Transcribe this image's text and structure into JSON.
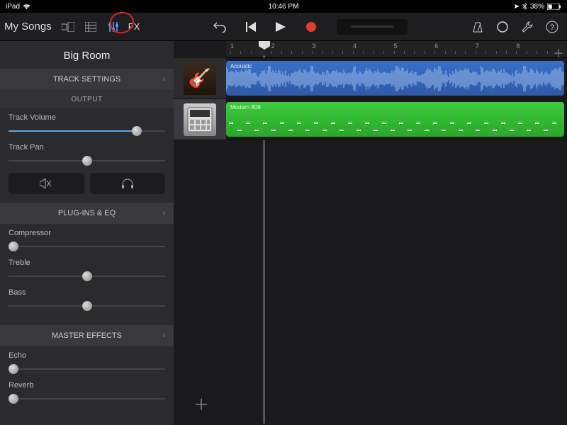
{
  "status": {
    "device": "iPad",
    "time": "10:46 PM",
    "battery": "38%"
  },
  "toolbar": {
    "my_songs": "My Songs",
    "fx": "FX"
  },
  "song": {
    "title": "Big Room"
  },
  "sections": {
    "track_settings": "TRACK SETTINGS",
    "output": "OUTPUT",
    "plugins_eq": "PLUG-INS & EQ",
    "master_effects": "MASTER EFFECTS"
  },
  "output": {
    "track_volume_label": "Track Volume",
    "track_volume": 82,
    "track_pan_label": "Track Pan",
    "track_pan": 50
  },
  "plugins": {
    "compressor_label": "Compressor",
    "compressor": 0,
    "treble_label": "Treble",
    "treble": 45,
    "bass_label": "Bass",
    "bass": 45
  },
  "master": {
    "echo_label": "Echo",
    "echo": 0,
    "reverb_label": "Reverb",
    "reverb": 0
  },
  "ruler": {
    "bars": [
      1,
      2,
      3,
      4,
      5,
      6,
      7,
      8
    ]
  },
  "tracks": [
    {
      "name": "Acoustic",
      "instrument": "guitar",
      "region_label": "Acoustic",
      "color": "blue"
    },
    {
      "name": "Modern 808",
      "instrument": "drum-machine",
      "region_label": "Modern 808",
      "color": "green"
    }
  ]
}
